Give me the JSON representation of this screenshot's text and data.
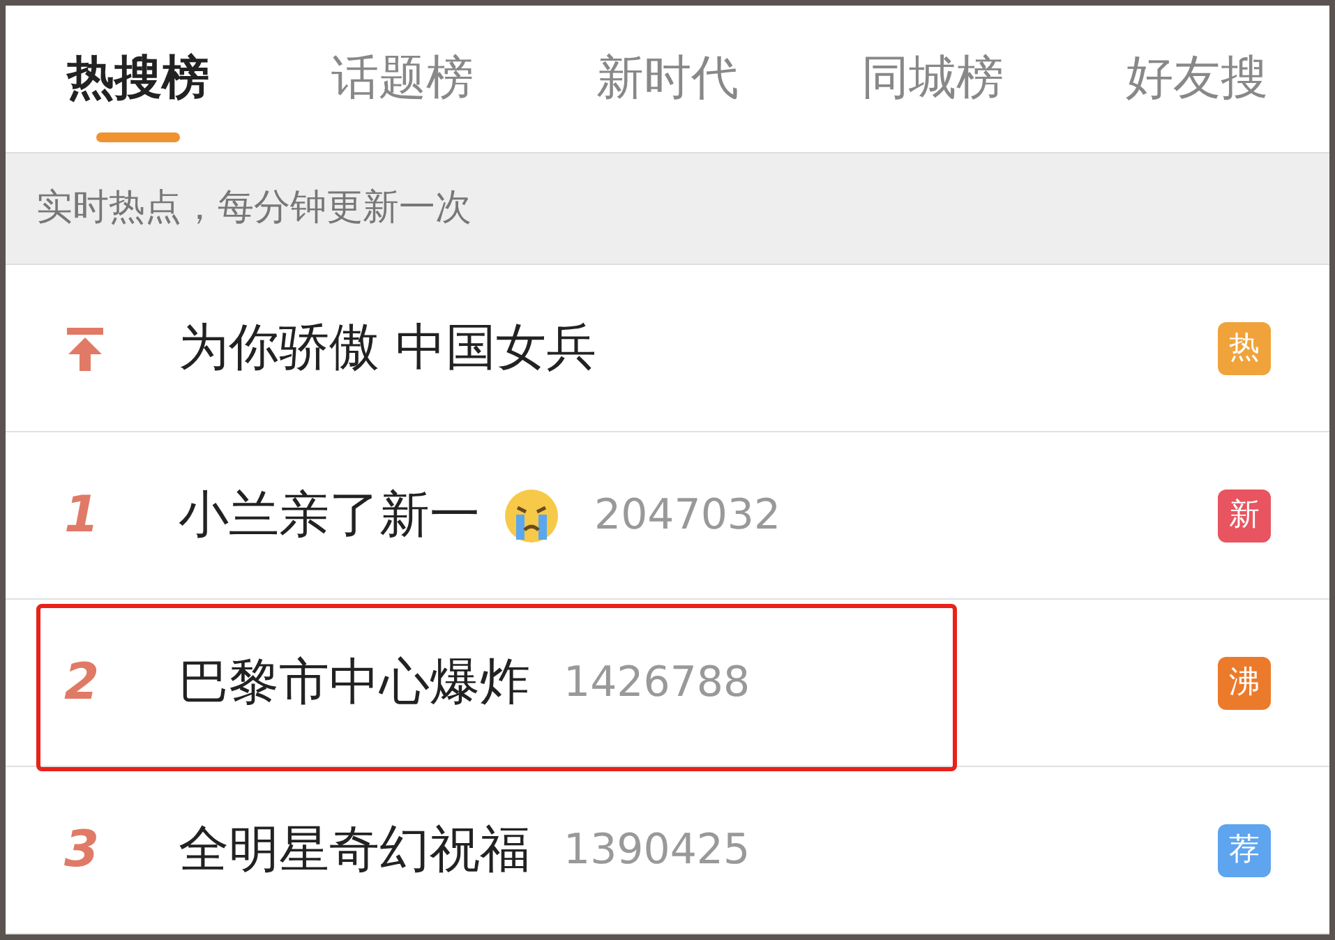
{
  "tabs": [
    {
      "label": "热搜榜",
      "selected": true
    },
    {
      "label": "话题榜",
      "selected": false
    },
    {
      "label": "新时代",
      "selected": false
    },
    {
      "label": "同城榜",
      "selected": false
    },
    {
      "label": "好友搜",
      "selected": false
    }
  ],
  "notice": "实时热点，每分钟更新一次",
  "rows": [
    {
      "kind": "pinned",
      "title": "为你骄傲 中国女兵",
      "crying_emoji": false,
      "highlighted": false,
      "badge": "热",
      "color": "#f0a33a"
    },
    {
      "kind": "ranked",
      "rank": "1",
      "title": "小兰亲了新一",
      "crying_emoji": true,
      "count": "2047032",
      "highlighted": false,
      "badge": "新",
      "color": "#e8545f"
    },
    {
      "kind": "ranked",
      "rank": "2",
      "title": "巴黎市中心爆炸",
      "crying_emoji": false,
      "count": "1426788",
      "highlighted": true,
      "badge": "沸",
      "color": "#ec7a2b"
    },
    {
      "kind": "ranked",
      "rank": "3",
      "title": "全明星奇幻祝福",
      "crying_emoji": false,
      "count": "1390425",
      "highlighted": false,
      "badge": "荐",
      "color": "#5ea4ee"
    }
  ]
}
